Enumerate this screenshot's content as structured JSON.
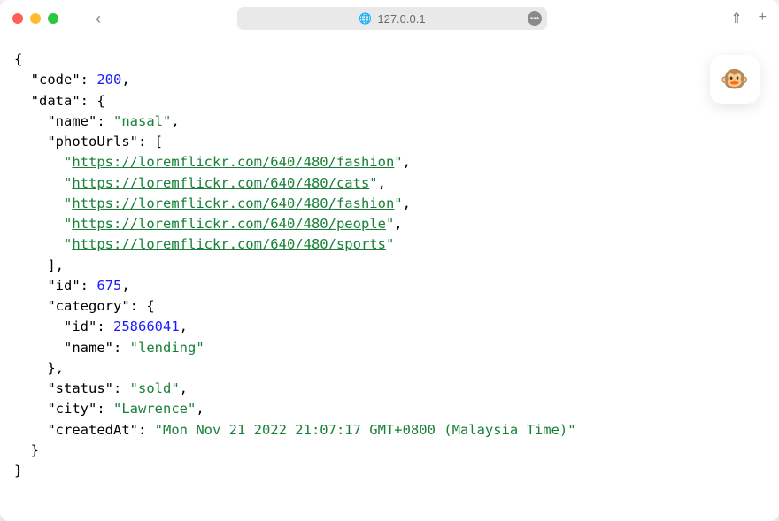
{
  "titlebar": {
    "address": "127.0.0.1"
  },
  "badge": {
    "emoji": "🐵"
  },
  "json": {
    "open_brace": "{",
    "code_key": "\"code\"",
    "code_val": "200",
    "data_key": "\"data\"",
    "name_key": "\"name\"",
    "name_val": "\"nasal\"",
    "photoUrls_key": "\"photoUrls\"",
    "urls": [
      "https://loremflickr.com/640/480/fashion",
      "https://loremflickr.com/640/480/cats",
      "https://loremflickr.com/640/480/fashion",
      "https://loremflickr.com/640/480/people",
      "https://loremflickr.com/640/480/sports"
    ],
    "id_key": "\"id\"",
    "id_val": "675",
    "category_key": "\"category\"",
    "cat_id_key": "\"id\"",
    "cat_id_val": "25866041",
    "cat_name_key": "\"name\"",
    "cat_name_val": "\"lending\"",
    "status_key": "\"status\"",
    "status_val": "\"sold\"",
    "city_key": "\"city\"",
    "city_val": "\"Lawrence\"",
    "createdAt_key": "\"createdAt\"",
    "createdAt_val": "\"Mon Nov 21 2022 21:07:17 GMT+0800 (Malaysia Time)\"",
    "close_brace": "}"
  }
}
